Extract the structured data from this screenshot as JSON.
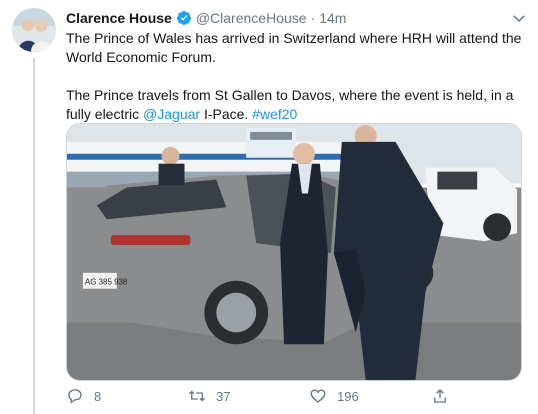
{
  "tweet": {
    "author_name": "Clarence House",
    "author_handle": "@ClarenceHouse",
    "separator": "·",
    "time": "14m",
    "text_part1": "The Prince of Wales has arrived in Switzerland where HRH will attend the World Economic Forum.",
    "text_part2_prefix": "The Prince travels from St Gallen to Davos, where the event is held, in a fully electric ",
    "text_mention": "@Jaguar",
    "text_part2_middle": " I-Pace. ",
    "text_hashtag": "#wef20",
    "verified": true
  },
  "actions": {
    "reply_count": "8",
    "retweet_count": "37",
    "like_count": "196"
  },
  "media": {
    "license_plate": "AG 385 938"
  },
  "colors": {
    "accent": "#1b95e0",
    "verified": "#1da1f2",
    "secondary_text": "#657786"
  },
  "icons": [
    "verified-badge-icon",
    "chevron-down-icon",
    "reply-icon",
    "retweet-icon",
    "like-icon",
    "share-icon"
  ]
}
